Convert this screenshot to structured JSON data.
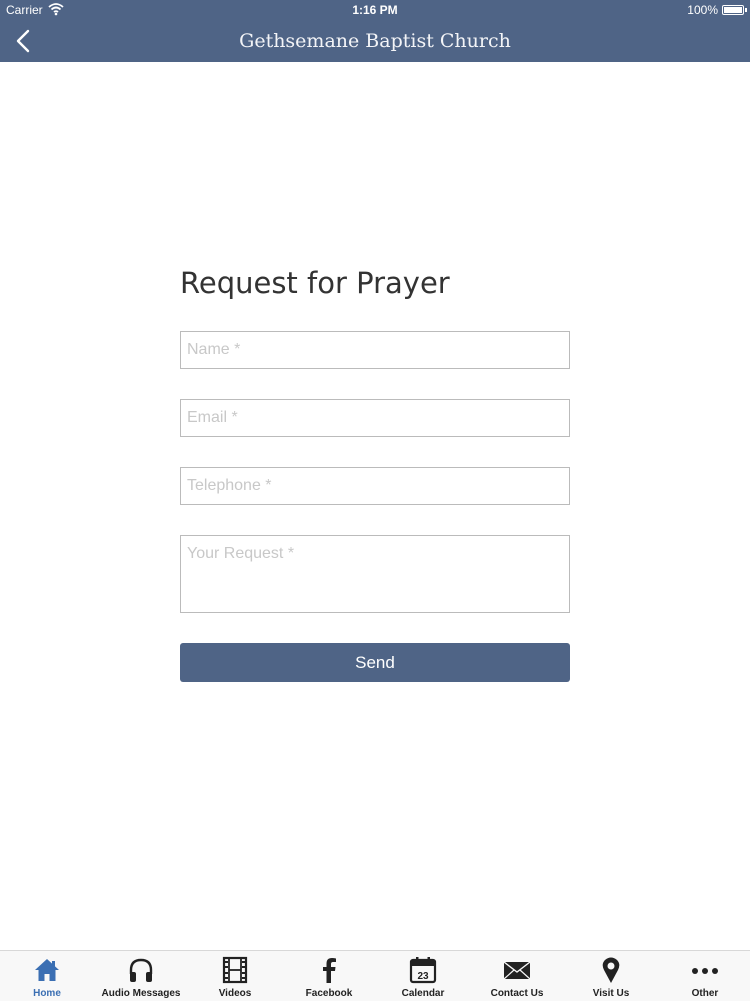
{
  "status_bar": {
    "carrier": "Carrier",
    "time": "1:16 PM",
    "battery": "100%"
  },
  "nav": {
    "title": "Gethsemane Baptist Church"
  },
  "form": {
    "title": "Request for Prayer",
    "name_placeholder": "Name *",
    "email_placeholder": "Email *",
    "telephone_placeholder": "Telephone *",
    "request_placeholder": "Your Request *",
    "send_label": "Send"
  },
  "tabs": [
    {
      "label": "Home",
      "icon": "home-icon",
      "active": true
    },
    {
      "label": "Audio Messages",
      "icon": "headphones-icon"
    },
    {
      "label": "Videos",
      "icon": "film-icon"
    },
    {
      "label": "Facebook",
      "icon": "facebook-icon"
    },
    {
      "label": "Calendar",
      "icon": "calendar-icon",
      "calendar_day": "23"
    },
    {
      "label": "Contact Us",
      "icon": "envelope-icon"
    },
    {
      "label": "Visit Us",
      "icon": "map-pin-icon"
    },
    {
      "label": "Other",
      "icon": "more-icon"
    }
  ],
  "colors": {
    "brand": "#4f6486",
    "active_tab": "#3b6fb3"
  }
}
